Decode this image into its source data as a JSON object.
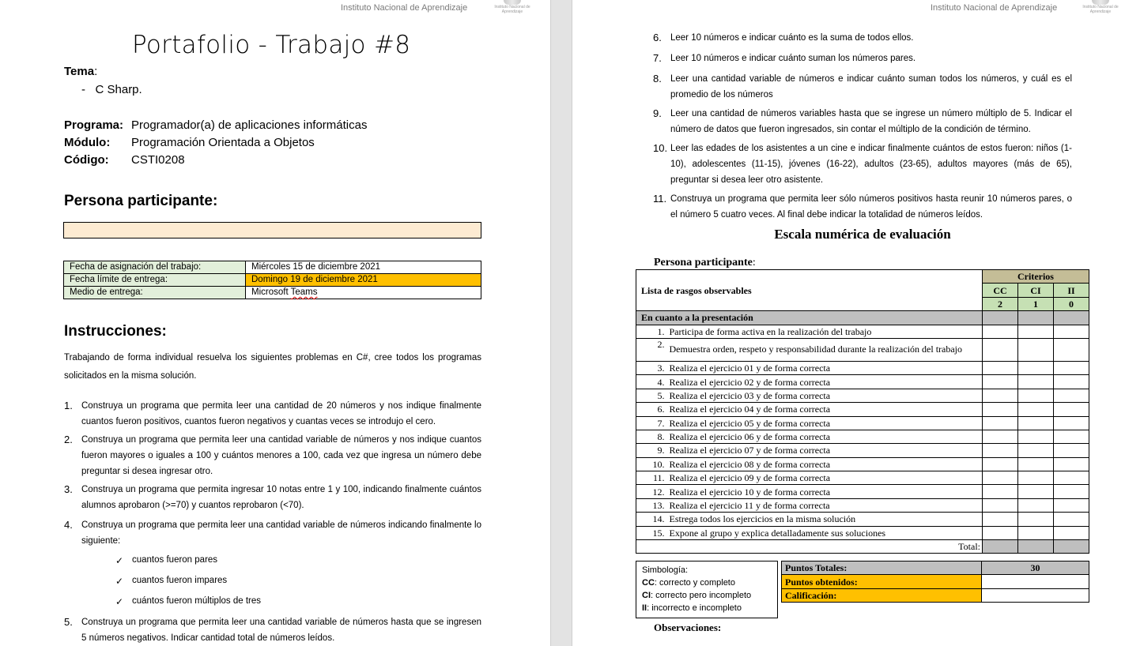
{
  "header": {
    "institution": "Instituto Nacional de Aprendizaje",
    "logo_text": "Instituto Nacional de Aprendizaje"
  },
  "left": {
    "title": "Portafolio - Trabajo #8",
    "tema_label": "Tema",
    "tema_item": "C Sharp.",
    "programa_label": "Programa:",
    "programa_value": "Programador(a) de aplicaciones informáticas",
    "modulo_label": "Módulo:",
    "modulo_value": "Programación Orientada a Objetos",
    "codigo_label": "Código:",
    "codigo_value": "CSTI0208",
    "persona_heading": "Persona participante:",
    "dates": [
      {
        "label": "Fecha de asignación del trabajo:",
        "value": "Miércoles 15 de diciembre 2021"
      },
      {
        "label": "Fecha límite de entrega:",
        "value": "Domingo 19 de diciembre 2021"
      },
      {
        "label": "Medio de entrega:",
        "value_a": "Microsoft ",
        "value_b": "Teams"
      }
    ],
    "instrucciones_heading": "Instrucciones:",
    "intro": "Trabajando de forma individual resuelva los siguientes problemas en C#, cree todos los programas solicitados en la misma solución.",
    "problems": [
      {
        "n": "1.",
        "text": "Construya un programa que permita leer una cantidad de 20 números y nos indique finalmente cuantos fueron positivos, cuantos fueron negativos y cuantas veces se introdujo el cero."
      },
      {
        "n": "2.",
        "text": "Construya un programa que permita leer una cantidad variable de números y nos indique cuantos fueron mayores o iguales a 100 y cuántos menores a 100, cada vez que ingresa un número debe preguntar si desea ingresar otro."
      },
      {
        "n": "3.",
        "text": "Construya un programa que permita ingresar 10 notas entre 1 y 100, indicando finalmente cuántos alumnos aprobaron (>=70) y cuantos reprobaron (<70)."
      },
      {
        "n": "4.",
        "text": "Construya un programa que permita leer una cantidad variable de números indicando finalmente lo siguiente:"
      },
      {
        "n": "5.",
        "text": "Construya un programa que permita leer una cantidad variable de números hasta que se ingresen 5 números negativos. Indicar cantidad total de números leídos."
      }
    ],
    "checks": [
      "cuantos fueron pares",
      "cuantos fueron impares",
      "cuántos fueron múltiplos de tres"
    ]
  },
  "right": {
    "problems": [
      {
        "n": "6.",
        "text": "Leer 10 números e indicar cuánto es la suma de todos ellos."
      },
      {
        "n": "7.",
        "text": "Leer 10 números e indicar cuánto suman los números pares."
      },
      {
        "n": "8.",
        "text": "Leer una cantidad variable de números e indicar cuánto suman todos los números, y cuál es el promedio de los números"
      },
      {
        "n": "9.",
        "text": "Leer una cantidad de números variables hasta que se ingrese un número múltiplo de 5. Indicar el número de datos que fueron ingresados, sin contar el múltiplo de la condición de término."
      },
      {
        "n": "10.",
        "text": "Leer las edades de los asistentes a un cine e indicar finalmente cuántos de estos fueron: niños (1-10), adolescentes (11-15), jóvenes (16-22), adultos (23-65), adultos mayores (más de 65), preguntar si desea leer otro asistente."
      },
      {
        "n": "11.",
        "text": "Construya un programa que permita leer sólo números positivos hasta reunir 10 números pares, o el número 5 cuatro veces. Al final debe indicar la totalidad de números leídos."
      }
    ],
    "escala_title": "Escala numérica de evaluación",
    "persona_label": "Persona participante",
    "table": {
      "rasgos_header": "Lista de rasgos observables",
      "criterios": "Criterios",
      "codes": [
        "CC",
        "CI",
        "II"
      ],
      "scores": [
        "2",
        "1",
        "0"
      ],
      "section": "En cuanto a la presentación",
      "rows": [
        {
          "n": "1.",
          "text": "Participa de forma activa en la realización del trabajo"
        },
        {
          "n": "2.",
          "text": "Demuestra orden, respeto y responsabilidad durante la realización del trabajo"
        },
        {
          "n": "3.",
          "text": "Realiza el ejercicio 01 y de forma correcta"
        },
        {
          "n": "4.",
          "text": "Realiza el ejercicio 02 y de forma correcta"
        },
        {
          "n": "5.",
          "text": "Realiza el ejercicio 03 y de forma correcta"
        },
        {
          "n": "6.",
          "text": "Realiza el ejercicio 04 y de forma correcta"
        },
        {
          "n": "7.",
          "text": "Realiza el ejercicio 05 y de forma correcta"
        },
        {
          "n": "8.",
          "text": "Realiza el ejercicio 06 y de forma correcta"
        },
        {
          "n": "9.",
          "text": "Realiza el ejercicio 07 y de forma correcta"
        },
        {
          "n": "10.",
          "text": "Realiza el ejercicio 08 y de forma correcta"
        },
        {
          "n": "11.",
          "text": "Realiza el ejercicio 09 y de forma correcta"
        },
        {
          "n": "12.",
          "text": "Realiza el ejercicio 10 y de forma correcta"
        },
        {
          "n": "13.",
          "text": "Realiza el ejercicio 11 y de forma correcta"
        },
        {
          "n": "14.",
          "text": "Estrega todos los ejercicios en la misma solución"
        },
        {
          "n": "15.",
          "text": "Expone al grupo y explica detalladamente sus soluciones"
        }
      ],
      "total_label": "Total:"
    },
    "simbologia": {
      "title": "Simbología:",
      "lines": [
        {
          "code": "CC",
          "text": ": correcto y completo"
        },
        {
          "code": "CI",
          "text": ": correcto pero incompleto"
        },
        {
          "code": "II",
          "text": ": incorrecto e incompleto"
        }
      ]
    },
    "summary": {
      "puntos_totales_label": "Puntos Totales:",
      "puntos_totales_value": "30",
      "puntos_obtenidos_label": "Puntos obtenidos:",
      "calificacion_label": "Calificación:"
    },
    "observaciones": "Observaciones:"
  }
}
